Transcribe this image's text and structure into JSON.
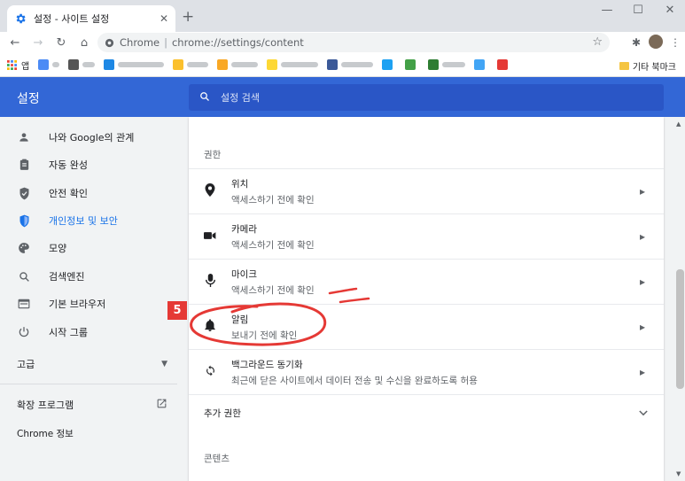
{
  "browser": {
    "tab_title": "설정 - 사이트 설정",
    "tab_close": "✕",
    "new_tab": "+",
    "min": "—",
    "max": "☐",
    "close": "✕",
    "site_label": "Chrome",
    "url_sep": "|",
    "url": "chrome://settings/content",
    "star": "☆",
    "bookmarks_first": "앱",
    "bookmarks_other": "기타 북마크"
  },
  "header": {
    "title": "설정",
    "search_placeholder": "설정 검색"
  },
  "sidebar": {
    "items": [
      {
        "label": "나와 Google의 관계",
        "icon": "person-icon"
      },
      {
        "label": "자동 완성",
        "icon": "clipboard-icon"
      },
      {
        "label": "안전 확인",
        "icon": "shield-check-icon"
      },
      {
        "label": "개인정보 및 보안",
        "icon": "shield-icon"
      },
      {
        "label": "모양",
        "icon": "palette-icon"
      },
      {
        "label": "검색엔진",
        "icon": "search-icon"
      },
      {
        "label": "기본 브라우저",
        "icon": "browser-icon"
      },
      {
        "label": "시작 그룹",
        "icon": "power-icon"
      }
    ],
    "advanced": "고급",
    "extensions": "확장 프로그램",
    "about": "Chrome 정보"
  },
  "main": {
    "permissions_title": "권한",
    "rows": [
      {
        "title": "위치",
        "sub": "액세스하기 전에 확인",
        "icon": "location-icon"
      },
      {
        "title": "카메라",
        "sub": "액세스하기 전에 확인",
        "icon": "camera-icon"
      },
      {
        "title": "마이크",
        "sub": "액세스하기 전에 확인",
        "icon": "mic-icon"
      },
      {
        "title": "알림",
        "sub": "보내기 전에 확인",
        "icon": "bell-icon"
      },
      {
        "title": "백그라운드 동기화",
        "sub": "최근에 닫은 사이트에서 데이터 전송 및 수신을 완료하도록 허용",
        "icon": "sync-icon"
      }
    ],
    "more_permissions": "추가 권한",
    "content_title": "콘텐츠"
  },
  "annotation": {
    "step": "5",
    "color": "#e53935"
  },
  "colors": {
    "header_blue": "#3367d6",
    "active_blue": "#1a73e8"
  }
}
